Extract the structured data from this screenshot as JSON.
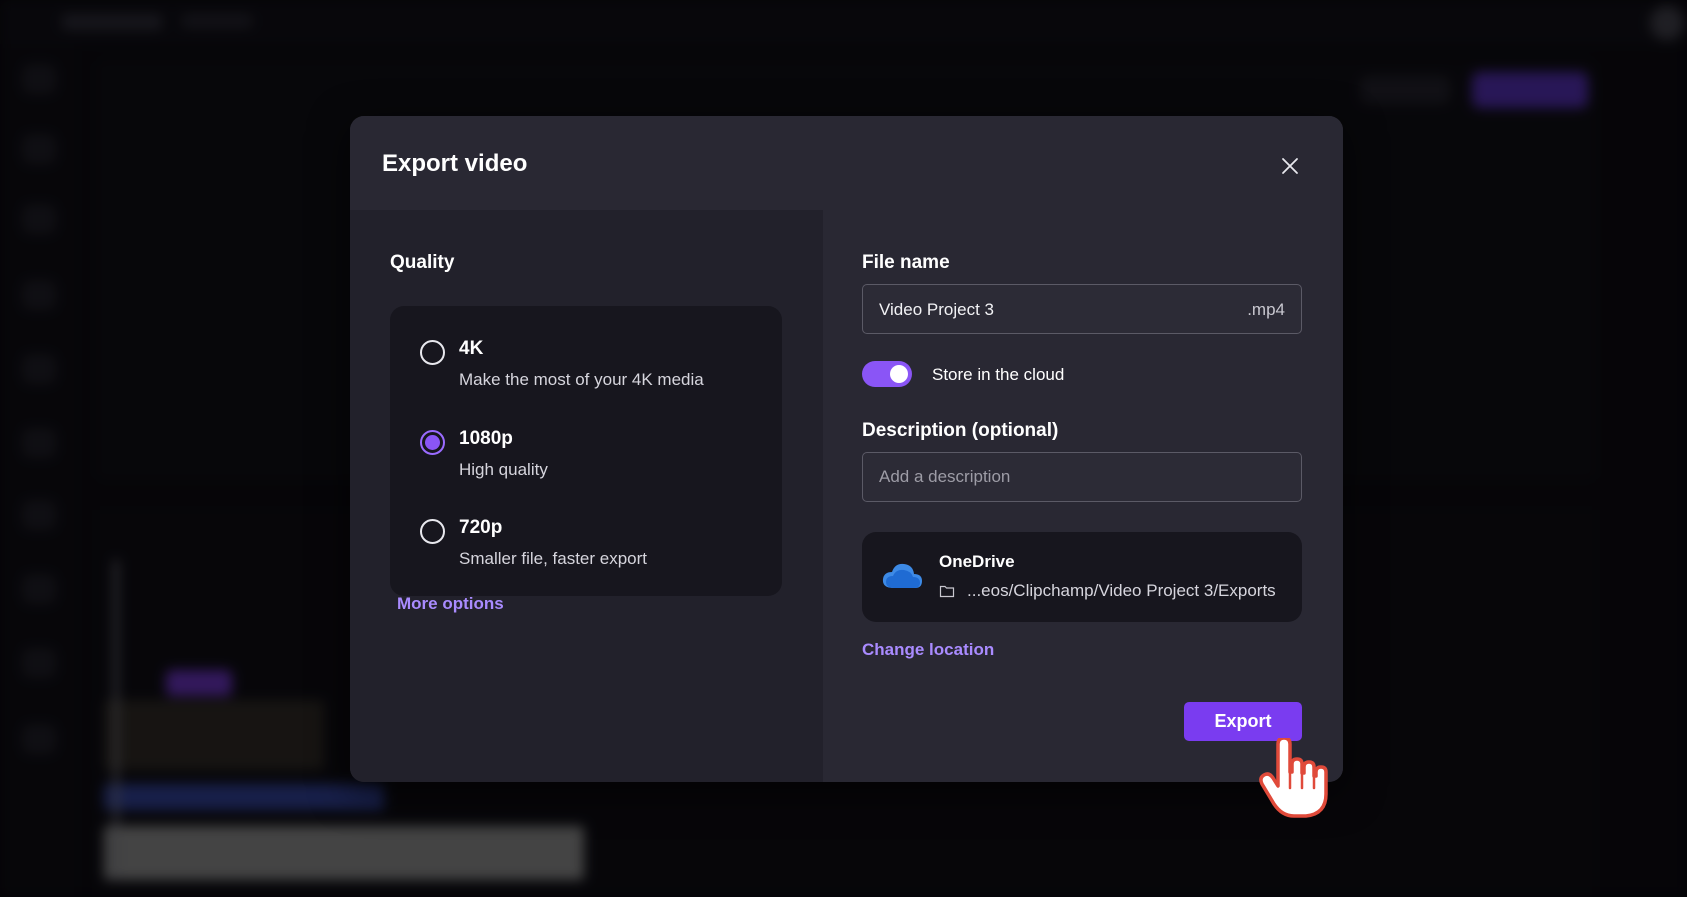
{
  "dialog": {
    "title": "Export video",
    "close_icon": "close-icon"
  },
  "quality": {
    "label": "Quality",
    "options": [
      {
        "title": "4K",
        "subtitle": "Make the most of your 4K media",
        "selected": false
      },
      {
        "title": "1080p",
        "subtitle": "High quality",
        "selected": true
      },
      {
        "title": "720p",
        "subtitle": "Smaller file, faster export",
        "selected": false
      }
    ],
    "more_options": "More options"
  },
  "file": {
    "label": "File name",
    "value": "Video Project 3",
    "extension": ".mp4"
  },
  "cloud": {
    "label": "Store in the cloud",
    "enabled": true
  },
  "description": {
    "label": "Description (optional)",
    "placeholder": "Add a description"
  },
  "location": {
    "provider": "OneDrive",
    "path": "...eos/Clipchamp/Video Project 3/Exports",
    "change_label": "Change location"
  },
  "actions": {
    "export_label": "Export"
  },
  "colors": {
    "accent": "#7a3cf0",
    "link": "#a98bff",
    "dialog_bg": "#292833",
    "panel_bg": "#17161e"
  }
}
